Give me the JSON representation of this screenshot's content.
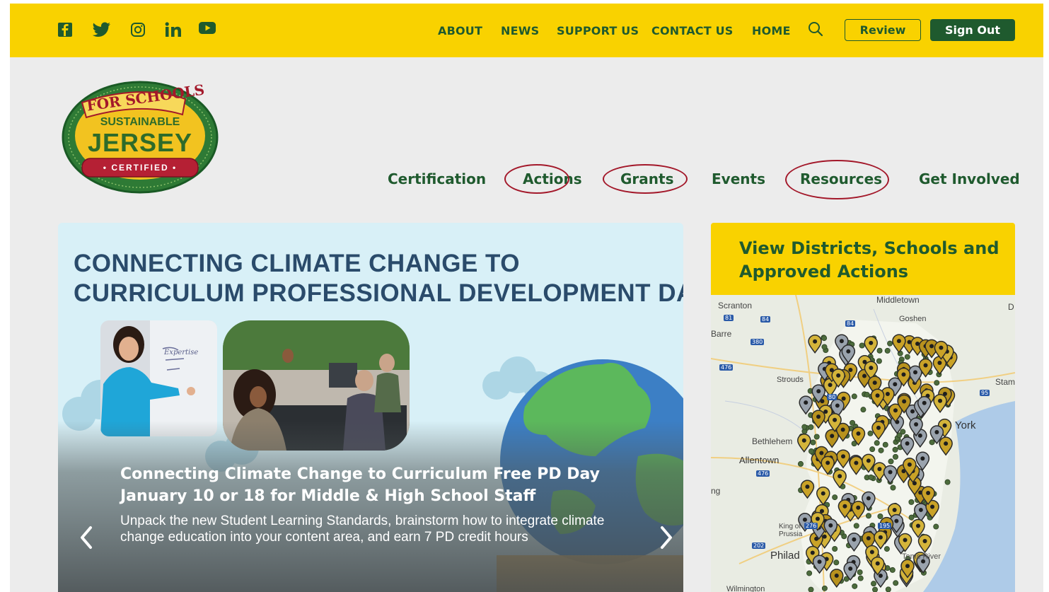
{
  "social": {
    "icons": [
      "facebook-icon",
      "twitter-icon",
      "instagram-icon",
      "linkedin-icon",
      "youtube-icon"
    ]
  },
  "topnav": {
    "items": [
      "ABOUT",
      "NEWS",
      "SUPPORT US",
      "CONTACT US",
      "HOME"
    ],
    "review_label": "Review",
    "signout_label": "Sign Out"
  },
  "logo": {
    "top": "FOR SCHOOLS",
    "line1": "SUSTAINABLE",
    "line2": "JERSEY",
    "badge": "• CERTIFIED •"
  },
  "mainnav": {
    "items": [
      "Certification",
      "Actions",
      "Grants",
      "Events",
      "Resources",
      "Get Involved"
    ]
  },
  "carousel": {
    "title_line1": "CONNECTING CLIMATE CHANGE TO",
    "title_line2": "CURRICULUM PROFESSIONAL DEVELOPMENT DAY",
    "headline_line1": "Connecting Climate Change to Curriculum Free PD Day",
    "headline_line2": "January 10 or 18 for Middle & High School Staff",
    "body": "Unpack the new Student Learning Standards, brainstorm how to integrate climate change education into your content area, and earn 7 PD credit hours",
    "whiteboard_text": "Expertise"
  },
  "mapcard": {
    "title": "View Districts, Schools and Approved Actions",
    "labels": {
      "scranton": "Scranton",
      "middletown": "Middletown",
      "goshen": "Goshen",
      "barre": "Barre",
      "stroudsburg": "Strouds",
      "york": "York",
      "stam": "Stam",
      "bethlehem": "Bethlehem",
      "allentown": "Allentown",
      "ng": "ng",
      "king_of_prussia": "King of Prussia",
      "philadelphia": "Philad",
      "wilmington": "Wilmington",
      "d": "D",
      "toms_river": "Toms River"
    },
    "shields": [
      "81",
      "84",
      "84",
      "380",
      "476",
      "80",
      "476",
      "476",
      "276",
      "95",
      "195",
      "202"
    ]
  },
  "colors": {
    "yellow": "#f9d200",
    "green": "#1f5a2e",
    "circle_red": "#a3182a",
    "grey_bg": "#ececec"
  }
}
